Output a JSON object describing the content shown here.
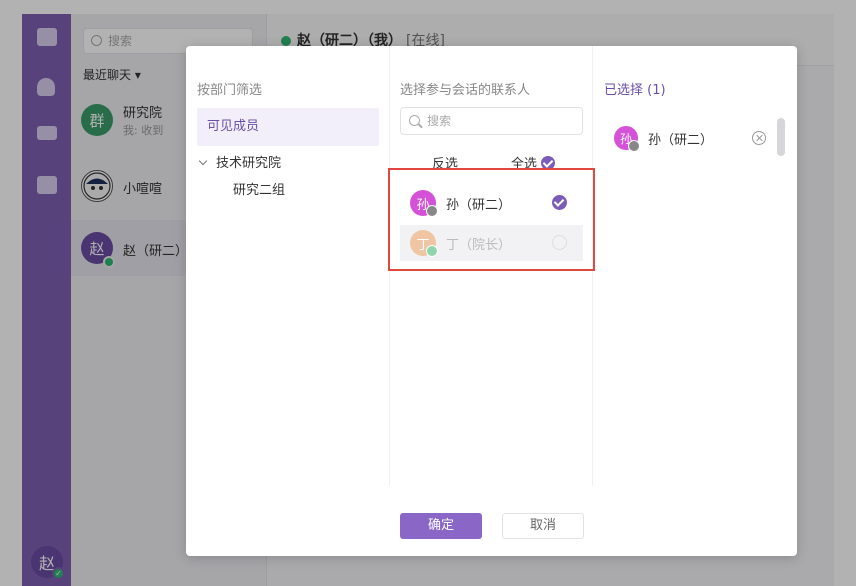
{
  "app": {
    "conversation_list": {
      "search_placeholder": "搜索",
      "recent_label": "最近聊天 ▾",
      "items": [
        {
          "avatar_text": "群",
          "name": "研究院",
          "preview": "我: 收到"
        },
        {
          "avatar_text": "",
          "name": "小喧喧",
          "preview": ""
        },
        {
          "avatar_text": "赵",
          "name": "赵（研二）",
          "preview": ""
        }
      ]
    },
    "chat_header": {
      "title": "赵（研二）（我）",
      "status": "[在线]"
    },
    "me_avatar": "赵"
  },
  "dialog": {
    "filter_panel": {
      "title": "按部门筛选",
      "visible_members": "可见成员",
      "department": "技术研究院",
      "group": "研究二组"
    },
    "contacts_panel": {
      "title": "选择参与会话的联系人",
      "search_placeholder": "搜索",
      "invert_label": "反选",
      "select_all_label": "全选",
      "contacts": [
        {
          "avatar_text": "孙",
          "name": "孙（研二）",
          "checked": true,
          "disabled": false
        },
        {
          "avatar_text": "丁",
          "name": "丁（院长）",
          "checked": false,
          "disabled": true
        }
      ]
    },
    "selected_panel": {
      "title": "已选择 (1)",
      "items": [
        {
          "avatar_text": "孙",
          "name": "孙（研二）"
        }
      ]
    },
    "buttons": {
      "confirm": "确定",
      "cancel": "取消"
    }
  },
  "colors": {
    "accent": "#7b5cb8",
    "sidebar": "#7d5fb0",
    "highlight": "#e0483f",
    "online": "#2eb872"
  }
}
